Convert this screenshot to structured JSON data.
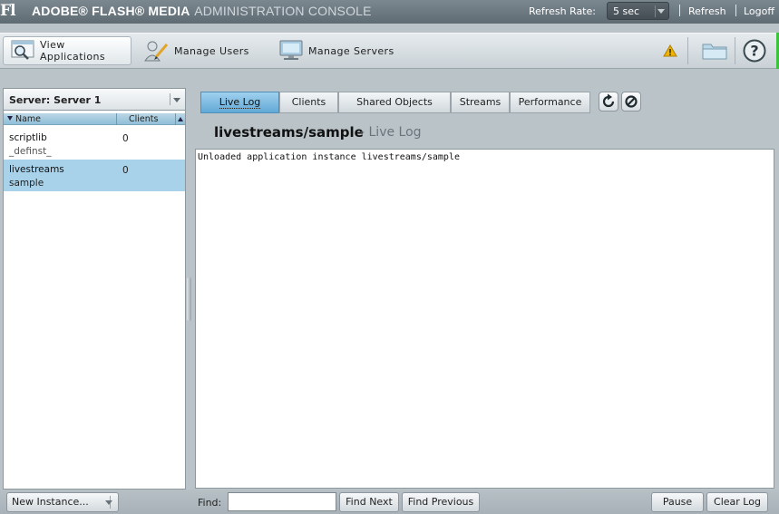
{
  "titlebar": {
    "logo": "Fl",
    "title_bold": "ADOBE® FLASH® MEDIA",
    "title_rest": "ADMINISTRATION CONSOLE",
    "refresh_rate_label": "Refresh Rate:",
    "refresh_rate_value": "5 sec",
    "refresh_link": "Refresh",
    "logoff_link": "Logoff"
  },
  "toolbar": {
    "view_applications": "View Applications",
    "manage_users": "Manage Users",
    "manage_servers": "Manage Servers",
    "icons": [
      "warning-icon",
      "folder-icon",
      "help-icon"
    ]
  },
  "left_panel": {
    "server_select": "Server: Server 1",
    "columns": {
      "name": "Name",
      "clients": "Clients"
    },
    "rows": [
      {
        "app": "scriptlib",
        "instance": "_definst_",
        "clients": "0",
        "selected": false
      },
      {
        "app": "livestreams",
        "instance": "sample",
        "clients": "0",
        "selected": true
      }
    ],
    "new_instance_button": "New Instance..."
  },
  "tabs": {
    "items": [
      "Live Log",
      "Clients",
      "Shared Objects",
      "Streams",
      "Performance"
    ],
    "active": "Live Log"
  },
  "main": {
    "instance_title": "livestreams/sample",
    "instance_subtitle": "- Live Log",
    "log_lines": [
      "Unloaded application instance livestreams/sample"
    ]
  },
  "bottom": {
    "find_label": "Find:",
    "find_value": "",
    "find_next": "Find Next",
    "find_previous": "Find Previous",
    "pause": "Pause",
    "clear_log": "Clear Log"
  },
  "colors": {
    "accent_blue": "#62a9d6",
    "selected_row": "#a8d2ea",
    "warning": "#f0b400",
    "status_green": "#3cc33c"
  }
}
